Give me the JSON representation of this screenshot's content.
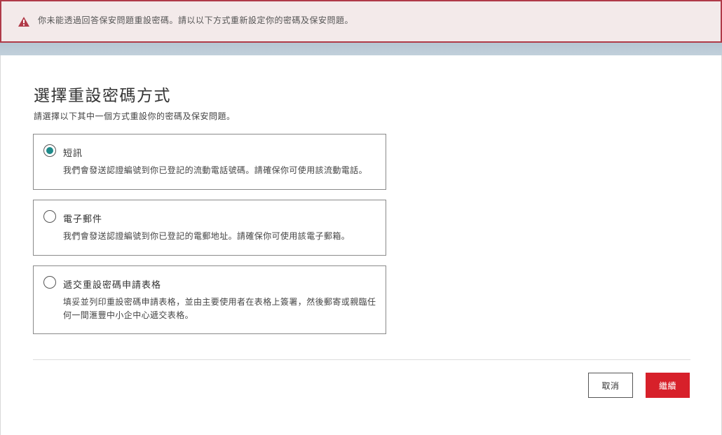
{
  "alert": {
    "icon": "warning-icon",
    "message": "你未能透過回答保安問題重設密碼。請以以下方式重新設定你的密碼及保安問題。",
    "color": "#b03a48"
  },
  "dialog": {
    "title": "選擇重設密碼方式",
    "subtitle": "請選擇以下其中一個方式重設你的密碼及保安問題。",
    "options": [
      {
        "label": "短訊",
        "description": "我們會發送認證編號到你已登記的流動電話號碼。請確保你可使用該流動電話。",
        "selected": true
      },
      {
        "label": "電子郵件",
        "description": "我們會發送認證編號到你已登記的電郵地址。請確保你可使用該電子郵箱。",
        "selected": false
      },
      {
        "label": "遞交重設密碼申請表格",
        "description": "填妥並列印重設密碼申請表格，並由主要使用者在表格上簽署，然後郵寄或親臨任何一間滙豐中小企中心遞交表格。",
        "selected": false
      }
    ],
    "buttons": {
      "cancel": "取消",
      "continue": "繼續"
    }
  },
  "colors": {
    "accent": "#d7202a",
    "radio_selected": "#1e8a8a"
  }
}
